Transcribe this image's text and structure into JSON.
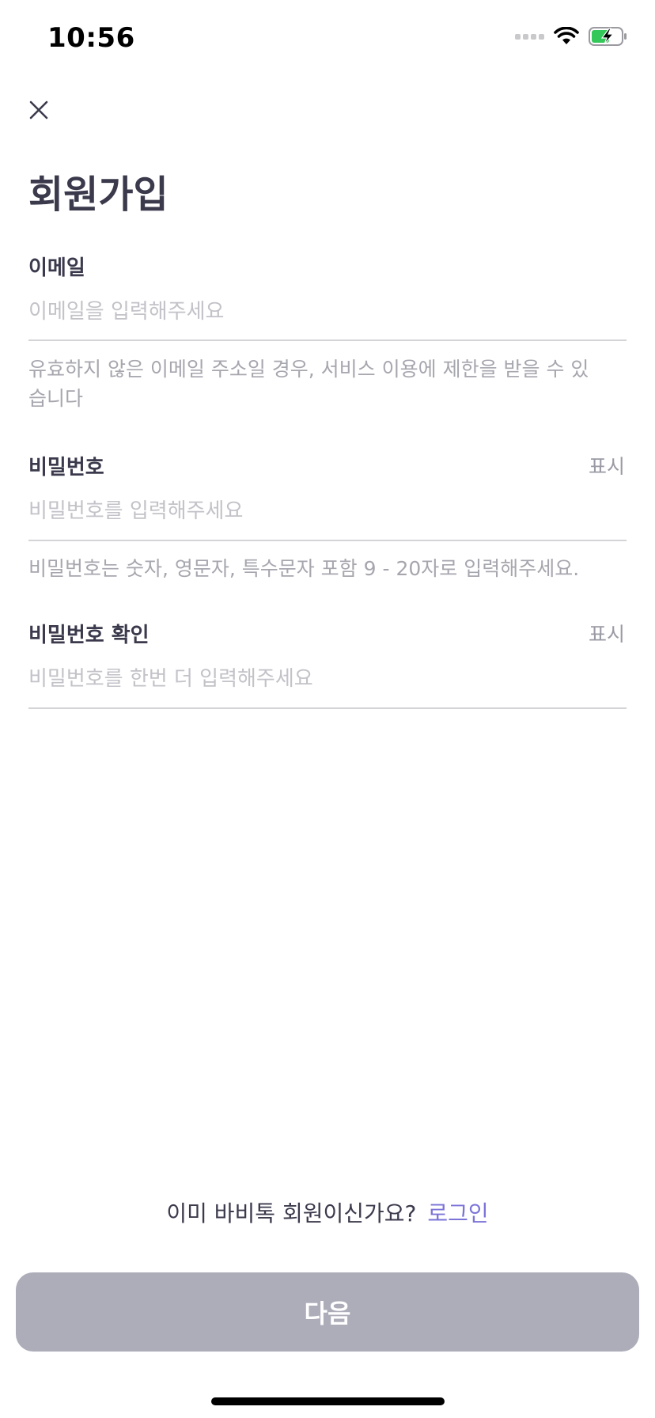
{
  "status_bar": {
    "time": "10:56"
  },
  "page": {
    "title": "회원가입"
  },
  "email": {
    "label": "이메일",
    "placeholder": "이메일을 입력해주세요",
    "help_line1": "유효하지 않은 이메일 주소일 경우, 서비스 이용에 제한을 받을 수 있",
    "help_line2": "습니다"
  },
  "password": {
    "label": "비밀번호",
    "toggle": "표시",
    "placeholder": "비밀번호를 입력해주세요",
    "help": "비밀번호는 숫자, 영문자, 특수문자 포함 9 - 20자로 입력해주세요."
  },
  "password_confirm": {
    "label": "비밀번호 확인",
    "toggle": "표시",
    "placeholder": "비밀번호를 한번 더 입력해주세요"
  },
  "footer": {
    "login_prompt": "이미 바비톡 회원이신가요?",
    "login_link": "로그인",
    "next_button": "다음"
  },
  "colors": {
    "accent": "#7b73d8",
    "button_disabled": "#adadba",
    "battery_charging": "#34c759"
  },
  "icons": [
    "close-icon",
    "wifi-icon",
    "battery-charging-icon",
    "signal-icon"
  ]
}
